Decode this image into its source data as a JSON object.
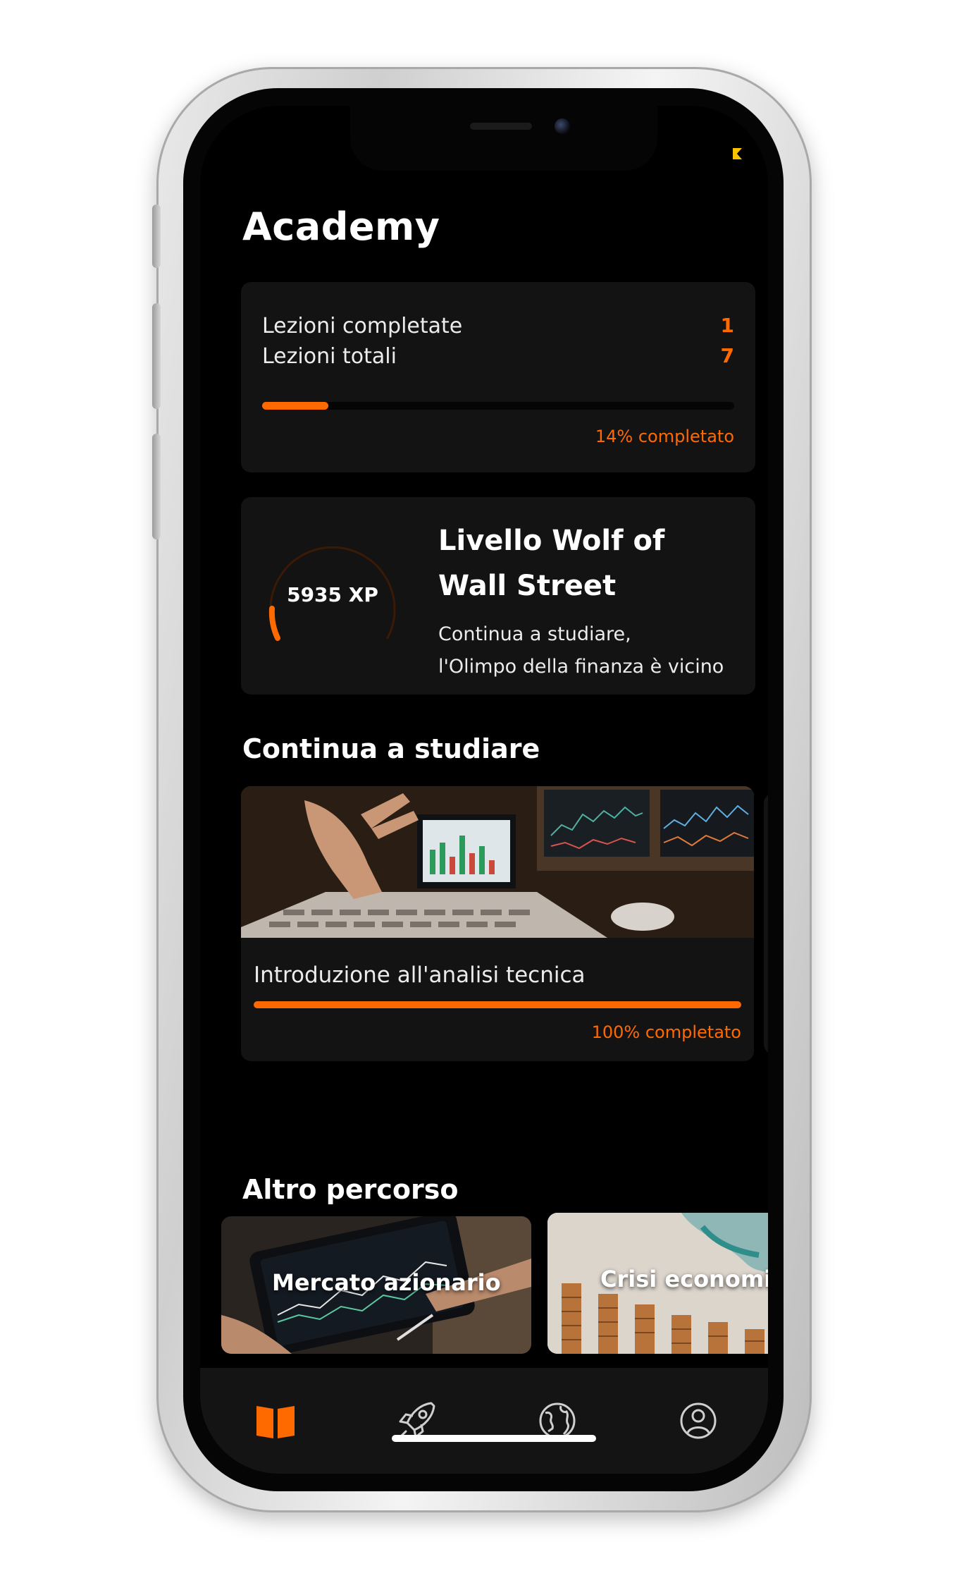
{
  "header": {
    "title": "Academy"
  },
  "lessons": {
    "completed_label": "Lezioni completate",
    "completed_value": "1",
    "total_label": "Lezioni totali",
    "total_value": "7",
    "progress_fraction": 0.14,
    "progress_text": "14% completato"
  },
  "level": {
    "xp_text": "5935 XP",
    "title": "Livello Wolf of Wall Street",
    "subtitle_line1": "Continua a studiare,",
    "subtitle_line2": "l'Olimpo della finanza è vicino"
  },
  "continue_section": {
    "title": "Continua a studiare",
    "course": {
      "label": "Introduzione all'analisi tecnica",
      "progress_fraction": 1.0,
      "progress_text": "100% completato"
    }
  },
  "other_section": {
    "title": "Altro percorso",
    "paths": [
      {
        "label": "Mercato azionario"
      },
      {
        "label": "Crisi economiche"
      }
    ]
  },
  "tabbar": {
    "tabs": [
      {
        "icon": "book-icon",
        "active": true
      },
      {
        "icon": "rocket-icon",
        "active": false
      },
      {
        "icon": "globe-icon",
        "active": false
      },
      {
        "icon": "profile-icon",
        "active": false
      }
    ]
  },
  "colors": {
    "accent": "#ff6a00",
    "background": "#000000",
    "card": "#131313",
    "status_indicator": "#f7c400"
  }
}
